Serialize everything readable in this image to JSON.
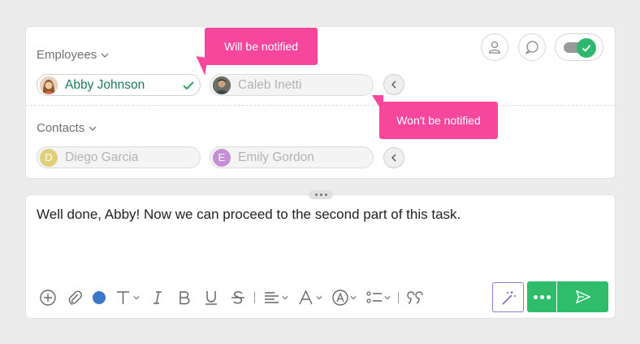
{
  "recipients": {
    "employees": {
      "label": "Employees",
      "people": [
        {
          "name": "Abby Johnson",
          "active": true
        },
        {
          "name": "Caleb Inetti",
          "active": false
        }
      ]
    },
    "contacts": {
      "label": "Contacts",
      "people": [
        {
          "name": "Diego Garcia",
          "initial": "D",
          "avatar_color": "#dfcf7a"
        },
        {
          "name": "Emily Gordon",
          "initial": "E",
          "avatar_color": "#c48fd8"
        }
      ]
    }
  },
  "tooltips": {
    "notified": "Will be notified",
    "not_notified": "Won't be notified"
  },
  "composer": {
    "message": "Well done, Abby! Now we can proceed to the second part of this task."
  },
  "colors": {
    "accent_green": "#2fbd6c",
    "tooltip_pink": "#f6479c",
    "text_color_dot": "#3b77c8"
  },
  "toggle": {
    "state": "on"
  }
}
